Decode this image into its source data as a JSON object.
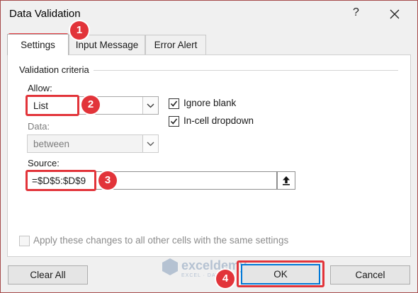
{
  "dialog": {
    "title": "Data Validation",
    "help_glyph": "?"
  },
  "tabs": [
    {
      "label": "Settings"
    },
    {
      "label": "Input Message"
    },
    {
      "label": "Error Alert"
    }
  ],
  "criteria": {
    "group_label": "Validation criteria",
    "allow": {
      "label": "Allow:",
      "value": "List"
    },
    "data": {
      "label": "Data:",
      "value": "between"
    },
    "ignore_blank": {
      "label": "Ignore blank",
      "checked": true
    },
    "incell_dropdown": {
      "label": "In-cell dropdown",
      "checked": true
    },
    "source": {
      "label": "Source:",
      "value": "=$D$5:$D$9"
    }
  },
  "apply_all": {
    "label": "Apply these changes to all other cells with the same settings",
    "checked": false
  },
  "buttons": {
    "clear_all": "Clear All",
    "ok": "OK",
    "cancel": "Cancel"
  },
  "annotations": {
    "step1": "1",
    "step2": "2",
    "step3": "3",
    "step4": "4",
    "highlight_color": "#e2343a"
  },
  "watermark": {
    "name": "exceldemy",
    "tagline": "EXCEL · DATA · BI"
  },
  "icons": {
    "close": "close-icon",
    "dropdown": "chevron-down-icon",
    "collapse": "collapse-range-icon",
    "check": "checkmark-icon"
  }
}
